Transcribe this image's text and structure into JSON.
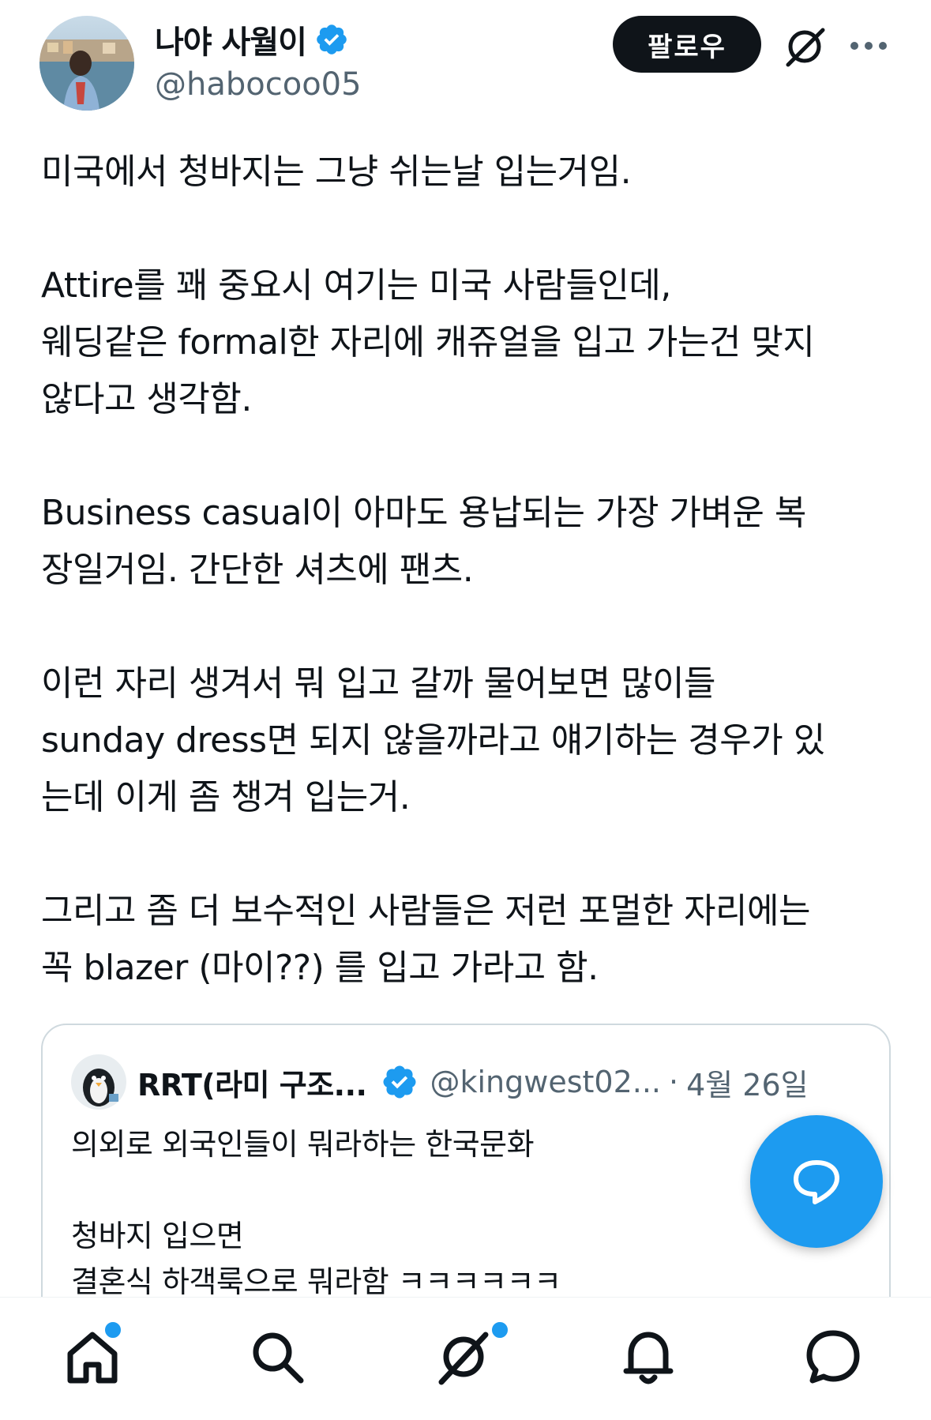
{
  "author": {
    "display_name": "나야 사월이",
    "handle": "@habocoo05"
  },
  "header": {
    "follow_label": "팔로우"
  },
  "tweet": {
    "paragraphs": [
      [
        "미국에서 청바지는 그냥 쉬는날 입는거임."
      ],
      [
        "Attire를 꽤 중요시 여기는 미국 사람들인데,",
        "웨딩같은 formal한 자리에 캐쥬얼을 입고 가는건 맞지",
        "않다고 생각함."
      ],
      [
        "Business casual이 아마도 용납되는 가장 가벼운 복",
        "장일거임. 간단한 셔츠에 팬츠."
      ],
      [
        "이런 자리 생겨서 뭐 입고 갈까 물어보면 많이들",
        "sunday dress면 되지 않을까라고 얘기하는 경우가 있",
        "는데 이게 좀 챙겨 입는거."
      ],
      [
        "그리고 좀 더 보수적인 사람들은 저런 포멀한 자리에는",
        "꼭 blazer (마이??) 를 입고 가라고 함."
      ]
    ]
  },
  "quote": {
    "display_name": "RRT(라미 구조...",
    "handle": "@kingwest02...",
    "separator": "·",
    "date": "4월 26일",
    "lines": [
      "의외로 외국인들이 뭐라하는 한국문화",
      "",
      "청바지 입으면",
      "결혼식 하객룩으로 뭐라함 ㅋㅋㅋㅋㅋㅋ"
    ]
  },
  "icons": {
    "verified": "verified-badge-icon",
    "grok": "grok-icon",
    "more": "more-icon",
    "compose": "compose-reply-icon",
    "nav": [
      "home-icon",
      "search-icon",
      "grok-icon",
      "bell-icon",
      "messages-icon"
    ]
  },
  "colors": {
    "accent": "#1d9bf0",
    "text": "#0f1419",
    "muted": "#536471",
    "border": "#cfd9de"
  }
}
